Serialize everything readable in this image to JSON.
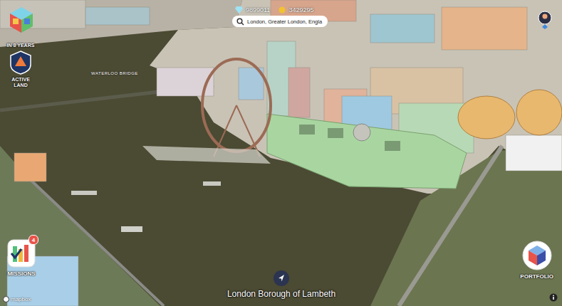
{
  "stats": [
    {
      "kind": "gems",
      "value": "9899011"
    },
    {
      "kind": "coins",
      "value": "3429295"
    }
  ],
  "search": {
    "value": "London, Greater London, Engla"
  },
  "sidebar": {
    "timer": "IN 8 YEARS",
    "active_land": "ACTIVE LAND"
  },
  "map": {
    "labels": [
      "WATERLOO BRIDGE"
    ],
    "attribution": "mapbox"
  },
  "missions": {
    "label": "MISSIONS",
    "badge": "4"
  },
  "portfolio": {
    "label": "PORTFOLIO"
  },
  "location": {
    "name": "London Borough of Lambeth"
  }
}
